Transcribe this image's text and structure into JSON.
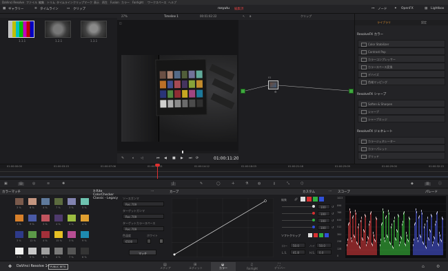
{
  "menubar": {
    "items": [
      "DaVinci Resolve",
      "ファイル",
      "編集",
      "トリム",
      "タイムライン",
      "クリップ",
      "マーク",
      "表示",
      "再生",
      "Fusion",
      "カラー",
      "Fairlight",
      "ワークスペース",
      "ヘルプ"
    ]
  },
  "toolbar": {
    "gallery_label": "ギャラリー",
    "timeline_label": "タイムライン",
    "clip_label": "クリップ",
    "project_name": "rosyutu",
    "edited_label": "編集済",
    "node_label": "ノード",
    "openfx_label": "OpenFX",
    "lightbox_label": "Lightbox"
  },
  "gallery": {
    "thumbs": [
      {
        "label": "1.1.1"
      },
      {
        "label": "1.2.1"
      },
      {
        "label": "1.3.1"
      }
    ]
  },
  "viewer": {
    "zoom": "27%",
    "timeline_name": "Timeline 1",
    "source_timecode": "00:01:02:22",
    "timecode": "01:00:11:20"
  },
  "nodes": {
    "clip_label": "クリップ",
    "node_num": "01"
  },
  "fx": {
    "tab_library": "ライブラリ",
    "tab_settings": "設定",
    "sections": [
      {
        "title": "ResolveFX カラー",
        "items": [
          "Color Stabilizer",
          "Contrast Pop",
          "カラーコンプレッサー",
          "カラースペース変換",
          "デハイズ",
          "色域マッピング"
        ]
      },
      {
        "title": "ResolveFX シャープ",
        "items": [
          "Soften & Sharpen",
          "シャープ",
          "シャープエッジ"
        ]
      },
      {
        "title": "ResolveFX ジェネレート",
        "items": [
          "カラージェネレーター",
          "カラーパレット",
          "グリッド"
        ]
      }
    ]
  },
  "timeline": {
    "ticks": [
      "01:00:00:00",
      "01:00:03:15",
      "01:00:07:06",
      "01:00:10:21",
      "01:00:14:12",
      "01:00:18:03",
      "01:00:21:18",
      "01:00:25:09",
      "01:00:29:00",
      "01:00:32:15"
    ]
  },
  "bottom": {
    "swatch_title": "カラーマッチ",
    "chart_name": "X-Rite ColorChecker Classic - Legacy",
    "swatch_rows": [
      {
        "colors": [
          "#7a5a4c",
          "#c49680",
          "#5f7a9c",
          "#5c6b3f",
          "#8283b0",
          "#6ec3b0"
        ],
        "labels": [
          "3 %",
          "6 %",
          "4 %",
          "7 %",
          "3 %",
          "5 %"
        ]
      },
      {
        "colors": [
          "#d8802a",
          "#4a5aa6",
          "#c0545e",
          "#4e3a6c",
          "#9cbc40",
          "#e0a030"
        ],
        "labels": [
          "3 %",
          "9 %",
          "3 %",
          "4 %",
          "4 %",
          "4 %"
        ]
      },
      {
        "colors": [
          "#2e3a8a",
          "#5c9a48",
          "#a4303a",
          "#e6c024",
          "#b84e94",
          "#1e8ab0"
        ],
        "labels": [
          "3 %",
          "12 %",
          "4 %",
          "15 %",
          "3 %",
          "9 %"
        ]
      },
      {
        "colors": [
          "#f2f2f0",
          "#c8c8c8",
          "#a0a0a0",
          "#7a7a7a",
          "#555555",
          "#343434"
        ],
        "labels": [
          "3 %",
          "5 %",
          "6 %",
          "4 %",
          "7 %",
          "6 %"
        ]
      }
    ],
    "settings": {
      "source_gamma_label": "ソースガンマ",
      "source_gamma": "Rec.709",
      "target_gamma_label": "ターゲットガンマ",
      "target_gamma": "Rec.709",
      "target_cs_label": "ターゲットカラースペース",
      "target_cs": "Rec.709",
      "temp_label": "色温度",
      "temp_value": "6500",
      "white_label": "ホワイト",
      "match_button": "マッチ"
    },
    "curves_title": "カーブ",
    "custom_title": "カスタム",
    "edit_label": "編集",
    "curve_values": [
      "100",
      "100",
      "100",
      "100"
    ],
    "softclip_label": "ソフトクリップ",
    "low_label": "ロー",
    "low_value": "50.0",
    "high_label": "ハイ",
    "high_value": "50.0",
    "ls_label": "L.S.",
    "ls_value": "41.8",
    "hs_label": "H.S.",
    "hs_value": "0.0",
    "scope_title": "スコープ",
    "scope_mode": "パレード",
    "scope_ticks": [
      "1023",
      "896",
      "768",
      "640",
      "512",
      "384",
      "256",
      "128",
      "0"
    ]
  },
  "appbar": {
    "app_name": "DaVinci Resolve 14",
    "beta_label": "PUBLIC BETA",
    "pages": [
      "メディア",
      "エディット",
      "カラー",
      "Fairlight",
      "デリバー"
    ]
  }
}
